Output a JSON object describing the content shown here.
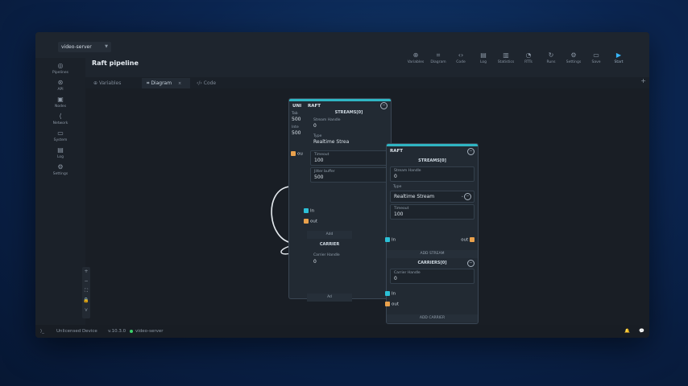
{
  "server_select": "video-server",
  "page_title": "Raft pipeline",
  "toolbar": [
    {
      "icon": "variables-icon",
      "glyph": "⊕",
      "label": "Variables"
    },
    {
      "icon": "diagram-icon",
      "glyph": "⌗",
      "label": "Diagram"
    },
    {
      "icon": "code-icon",
      "glyph": "‹›",
      "label": "Code"
    },
    {
      "icon": "log-icon",
      "glyph": "▤",
      "label": "Log"
    },
    {
      "icon": "statistics-icon",
      "glyph": "▥",
      "label": "Statistics"
    },
    {
      "icon": "rtts-icon",
      "glyph": "◔",
      "label": "RTTs"
    },
    {
      "icon": "runs-icon",
      "glyph": "↻",
      "label": "Runs"
    },
    {
      "icon": "settings-icon",
      "glyph": "⚙",
      "label": "Settings"
    },
    {
      "icon": "save-icon",
      "glyph": "▭",
      "label": "Save"
    },
    {
      "icon": "start-icon",
      "glyph": "▶",
      "label": "Start"
    }
  ],
  "sidebar": [
    {
      "icon": "pipelines-icon",
      "glyph": "◎",
      "label": "Pipelines"
    },
    {
      "icon": "api-icon",
      "glyph": "⊛",
      "label": "API"
    },
    {
      "icon": "nodes-icon",
      "glyph": "▣",
      "label": "Nodes"
    },
    {
      "icon": "network-icon",
      "glyph": "⟨",
      "label": "Network"
    },
    {
      "icon": "system-icon",
      "glyph": "▭",
      "label": "System"
    },
    {
      "icon": "log-icon",
      "glyph": "▤",
      "label": "Log"
    },
    {
      "icon": "settings-icon",
      "glyph": "⚙",
      "label": "Settings"
    }
  ],
  "tabs": [
    {
      "label": "Variables",
      "glyph": "⊕"
    },
    {
      "label": "Diagram",
      "glyph": "⌗",
      "close": "×"
    },
    {
      "label": "Code",
      "glyph": "‹/›"
    }
  ],
  "zoom": [
    "+",
    "−",
    "⛶",
    "🔒",
    "⋎"
  ],
  "nodes": {
    "back": {
      "tab_label": "UNI",
      "title": "RAFT",
      "streams_header": "STREAMS[0]",
      "stream_handle_label": "Stream Handle",
      "stream_handle_value": "0",
      "type_label": "Type",
      "type_value": "Realtime Strea",
      "timeout_label": "Timeout",
      "timeout_value": "100",
      "jitter_label": "Jitter buffer",
      "jitter_value": "500",
      "left_1": "Tab",
      "left_1_val": "500",
      "left_2": "Inte",
      "left_2_val": "500",
      "out_label": "ou",
      "in_port": "In",
      "out_port": "out",
      "add_label": "Add",
      "carriers_header": "CARRIER",
      "carrier_handle_label": "Carrier Handle",
      "carrier_handle_value": "0",
      "add2_label": "Ad"
    },
    "front": {
      "title": "RAFT",
      "streams_header": "STREAMS[0]",
      "stream_handle_label": "Stream Handle",
      "stream_handle_value": "0",
      "type_label": "Type",
      "type_value": "Realtime Stream",
      "timeout_label": "Timeout",
      "timeout_value": "100",
      "in_port": "In",
      "out_port": "out",
      "add_stream": "ADD STREAM",
      "carriers_header": "CARRIERS[0]",
      "carrier_handle_label": "Carrier Handle",
      "carrier_handle_value": "0",
      "carrier_in": "In",
      "carrier_out": "out",
      "add_carrier": "ADD CARRIER"
    }
  },
  "status": {
    "terminal": "⟩_",
    "device": "Unlicensed Device",
    "version": "v.10.3.0",
    "server": "video-server",
    "status_color": "#3ccf6b"
  }
}
